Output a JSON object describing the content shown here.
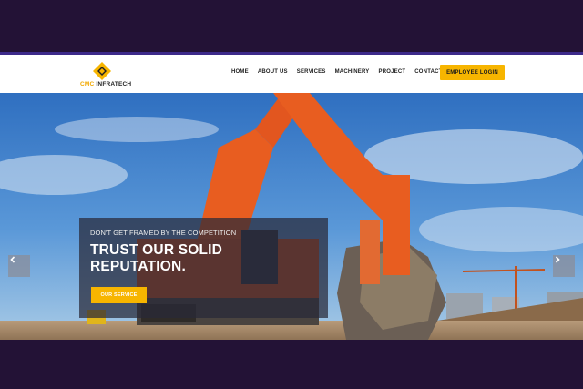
{
  "brand": {
    "name_prefix": "CMC",
    "name_suffix": "INFRATECH",
    "accent": "#f7b500"
  },
  "nav": {
    "items": [
      "HOME",
      "ABOUT US",
      "SERVICES",
      "MACHINERY",
      "PROJECT",
      "CONTACT"
    ],
    "login_label": "EMPLOYEE LOGIN"
  },
  "hero": {
    "tagline": "DON'T GET FRAMED BY THE COMPETITION",
    "headline_line1": "TRUST OUR SOLID",
    "headline_line2": "REPUTATION.",
    "cta_label": "OUR SERVICE",
    "prev_icon": "chevron-left-icon",
    "next_icon": "chevron-right-icon"
  },
  "colors": {
    "frame_bg": "#231236",
    "frame_border": "#3d2a8a",
    "button": "#f7b500"
  }
}
